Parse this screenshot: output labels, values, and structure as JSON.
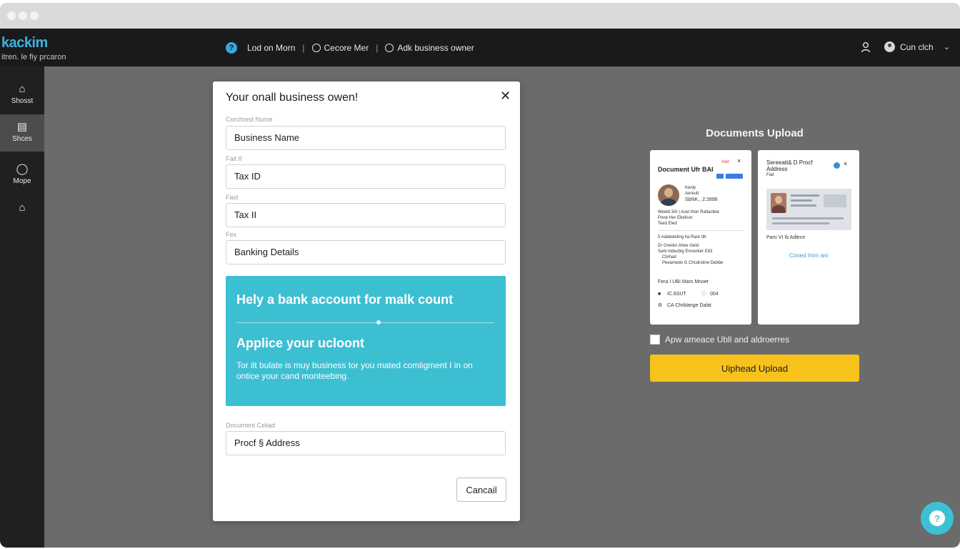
{
  "app": {
    "brand": "kackim",
    "brand_subtitle": "itren. le fiy prcaron"
  },
  "header": {
    "breadcrumbs": [
      "Lod on Morn",
      "Cecore Mer",
      "Adk business owner"
    ],
    "account_name": "Cun clch"
  },
  "sidebar": {
    "items": [
      {
        "label": "Shosst",
        "icon": "home-icon"
      },
      {
        "label": "Shces",
        "icon": "chart-icon"
      },
      {
        "label": "Mope",
        "icon": "shield-icon"
      },
      {
        "label": "",
        "icon": "home-outline-icon"
      }
    ]
  },
  "modal": {
    "title": "Your onall business owen!",
    "fields": [
      {
        "label": "Corchrest Nume",
        "value": "Business Name"
      },
      {
        "label": "Fait II",
        "value": "Tax ID"
      },
      {
        "label": "Fast",
        "value": "Tax II"
      },
      {
        "label": "Fex",
        "value": "Banking Details"
      }
    ],
    "promo": {
      "heading": "Hely a bank account for malk count",
      "subheading": "Applice your ucloont",
      "body": "Tor ilt bulate is muy business tor you mated comligment I in on ontice your cand monteebing."
    },
    "document_field": {
      "label": "Document Celiad",
      "value": "Procf § Address"
    },
    "cancel_label": "Cancail"
  },
  "documents": {
    "title": "Documents Upload",
    "card1": {
      "title": "Document Ufr BAI",
      "tag": "Add",
      "name": "Kenly",
      "role": "Aereutt",
      "id": "SbNK., 2:2898",
      "desc_lines": [
        "Weeld 3AI | Aset thon Rattactkie",
        "Pone Her Ebelicer",
        "Teed Eled"
      ],
      "lines": [
        "5 Adaledeling ha  Rare IIK",
        "Dr Gneilor Ahee  Geld",
        "Sark Indecbig  Emverker E83",
        "Cbrhad",
        "Peeamedo G Chcdrotine Debbe"
      ],
      "footer_title": "Fera I UBI Mars Mnoet",
      "footer_a": "IC.6SUT",
      "footer_b": "004",
      "footer_c": "CA Chrblange  Dalat"
    },
    "card2": {
      "title": "Sereeatt& D Procf Address",
      "sub": "Fad",
      "x_mark": "×",
      "caption": "Paro VI Ib Adlece",
      "link": "Coned Imm ani"
    },
    "checkbox_label": "Apw ameace Ubll and aldroerres",
    "upload_label": "Uiphead Upload"
  }
}
